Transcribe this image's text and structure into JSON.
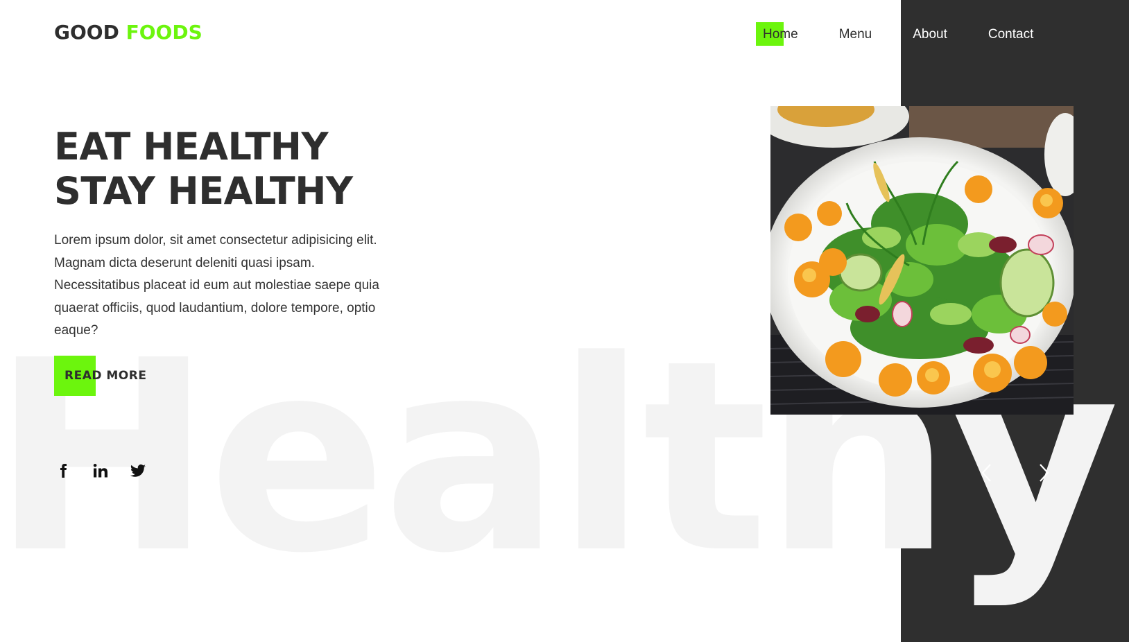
{
  "header": {
    "logo_part1": "GOOD",
    "logo_part2": "FOODS",
    "nav": [
      {
        "label": "Home",
        "active": true
      },
      {
        "label": "Menu",
        "active": false
      },
      {
        "label": "About",
        "active": false
      },
      {
        "label": "Contact",
        "active": false
      }
    ]
  },
  "hero": {
    "title_line1": "EAT HEALTHY",
    "title_line2": "STAY HEALTHY",
    "description": "Lorem ipsum dolor, sit amet consectetur adipisicing elit. Magnam dicta deserunt deleniti quasi ipsam. Necessitatibus placeat id eum aut molestiae saepe quia quaerat officiis, quod laudantium, dolore tempore, optio eaque?",
    "cta_label": "READ MORE",
    "background_word": "Healthy"
  },
  "socials": [
    {
      "icon": "facebook-icon"
    },
    {
      "icon": "linkedin-icon"
    },
    {
      "icon": "twitter-icon"
    }
  ],
  "slider": {
    "prev_icon": "chevron-left-icon",
    "next_icon": "chevron-right-icon"
  },
  "colors": {
    "accent": "#6cf50d",
    "text": "#2e2e2e",
    "dark_panel": "#2f2f2f",
    "background": "#ffffff",
    "watermark": "#f3f3f3"
  }
}
